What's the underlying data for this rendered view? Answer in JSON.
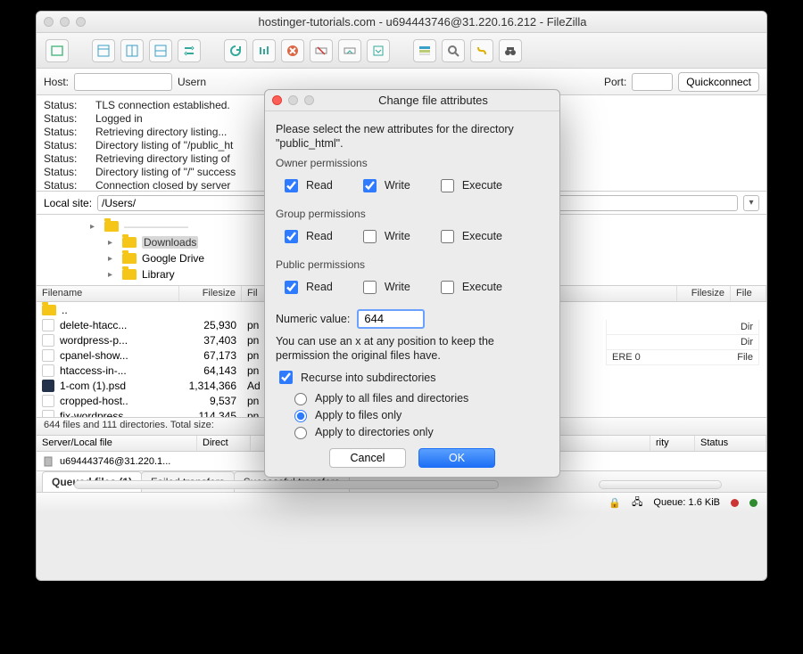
{
  "window": {
    "title": "hostinger-tutorials.com - u694443746@31.220.16.212 - FileZilla"
  },
  "conn": {
    "host_label": "Host:",
    "user_label": "Usern",
    "port_label": "Port:",
    "quickconnect": "Quickconnect"
  },
  "status": {
    "label": "Status:",
    "lines": [
      "TLS connection established.",
      "Logged in",
      "Retrieving directory listing...",
      "Directory listing of \"/public_ht",
      "Retrieving directory listing of",
      "Directory listing of \"/\" success",
      "Connection closed by server"
    ]
  },
  "local": {
    "label": "Local site:",
    "path": "/Users/",
    "tree": [
      {
        "name": "Downloads",
        "selected": true,
        "indent": 1
      },
      {
        "name": "Google Drive",
        "indent": 1
      },
      {
        "name": "Library",
        "indent": 1
      }
    ]
  },
  "cols_left": [
    "Filename",
    "Filesize",
    "Fil"
  ],
  "cols_right": [
    "Filesize",
    "File"
  ],
  "files": [
    {
      "name": "..",
      "size": "",
      "type": "",
      "parent": true
    },
    {
      "name": "delete-htacc...",
      "size": "25,930",
      "type": "pn"
    },
    {
      "name": "wordpress-p...",
      "size": "37,403",
      "type": "pn"
    },
    {
      "name": "cpanel-show...",
      "size": "67,173",
      "type": "pn"
    },
    {
      "name": "htaccess-in-...",
      "size": "64,143",
      "type": "pn"
    },
    {
      "name": "1-com (1).psd",
      "size": "1,314,366",
      "type": "Ad",
      "psd": true
    },
    {
      "name": "cropped-host..",
      "size": "9,537",
      "type": "pn"
    },
    {
      "name": "fix-wordpress",
      "size": "114,345",
      "type": "pn"
    }
  ],
  "right_frag": {
    "rows": [
      {
        "a": "",
        "b": "Dir"
      },
      {
        "a": "",
        "b": "Dir"
      },
      {
        "a": "ERE       0",
        "b": "File"
      }
    ]
  },
  "summary": "644 files and 111 directories. Total size:",
  "queue_cols": [
    "Server/Local file",
    "Direct",
    "rity",
    "Status"
  ],
  "queue_item": "u694443746@31.220.1...",
  "tabs": {
    "queued": "Queued files (1)",
    "failed": "Failed transfers",
    "success": "Successful transfers"
  },
  "footer": {
    "queue": "Queue: 1.6 KiB"
  },
  "modal": {
    "title": "Change file attributes",
    "intro": "Please select the new attributes for the directory \"public_html\".",
    "groups": {
      "owner": "Owner permissions",
      "group": "Group permissions",
      "public": "Public permissions"
    },
    "labels": {
      "read": "Read",
      "write": "Write",
      "execute": "Execute"
    },
    "perm": {
      "owner": {
        "read": true,
        "write": true,
        "execute": false
      },
      "group": {
        "read": true,
        "write": false,
        "execute": false
      },
      "public": {
        "read": true,
        "write": false,
        "execute": false
      }
    },
    "numeric_label": "Numeric value:",
    "numeric_value": "644",
    "hint": "You can use an x at any position to keep the permission the original files have.",
    "recurse_label": "Recurse into subdirectories",
    "recurse": true,
    "radios": {
      "all": "Apply to all files and directories",
      "files": "Apply to files only",
      "dirs": "Apply to directories only",
      "selected": "files"
    },
    "buttons": {
      "cancel": "Cancel",
      "ok": "OK"
    }
  },
  "toolbar_icons": [
    "site-manager-icon",
    "layout-icon",
    "layout2-icon",
    "layout3-icon",
    "sync-icon",
    "refresh-icon",
    "process-icon",
    "cancel-icon",
    "disconnect-icon",
    "reconnect-icon",
    "filter-icon",
    "queue-view-icon",
    "search-icon",
    "compare-icon",
    "binoculars-icon"
  ]
}
